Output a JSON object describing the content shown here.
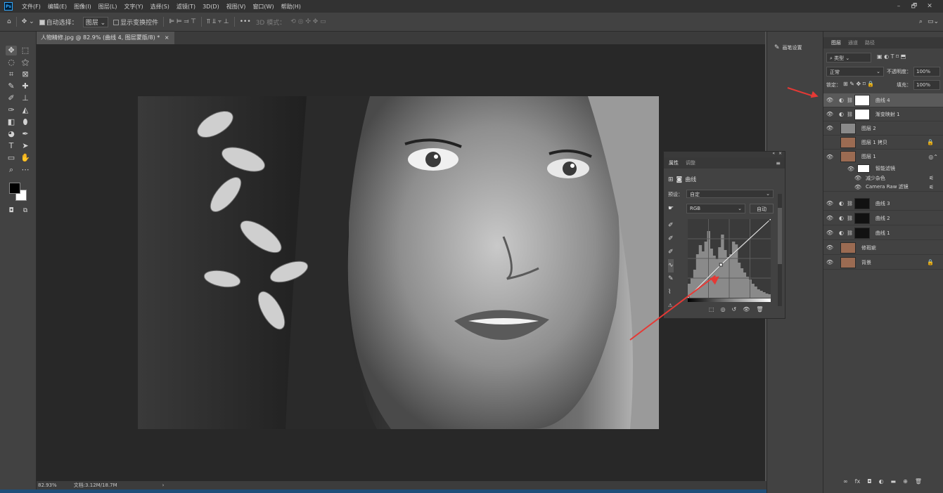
{
  "menubar": {
    "logo": "Ps",
    "items": [
      "文件(F)",
      "编辑(E)",
      "图像(I)",
      "图层(L)",
      "文字(Y)",
      "选择(S)",
      "滤镜(T)",
      "3D(D)",
      "视图(V)",
      "窗口(W)",
      "帮助(H)"
    ],
    "minimize": "–",
    "restore": "🗗",
    "close": "✕"
  },
  "options": {
    "auto_select_label": "自动选择：",
    "auto_select_target": "图层",
    "show_transform_label": "显示变换控件",
    "more": "•••",
    "mode_3d_label": "3D 模式："
  },
  "document": {
    "tab_title": "人物精修.jpg @ 82.9% (曲线 4, 图层蒙版/8) *",
    "tab_close": "×",
    "zoom": "82.93%",
    "file_info": "文档:3.12M/18.7M",
    "status_arrow": "›"
  },
  "brush_panel": {
    "label": "画笔设置"
  },
  "layers_panel": {
    "tabs": [
      "图层",
      "通道",
      "路径"
    ],
    "filter_kind": "类型",
    "blend_mode": "正常",
    "opacity_label": "不透明度：",
    "opacity_value": "100%",
    "lock_label": "锁定：",
    "fill_label": "填充：",
    "fill_value": "100%",
    "layers": [
      {
        "name": "曲线 4",
        "selected": true
      },
      {
        "name": "渐变映射 1",
        "selected": false
      },
      {
        "name": "图层 2",
        "selected": false
      },
      {
        "name": "图层 1 拷贝",
        "selected": false
      },
      {
        "name": "图层 1",
        "selected": false
      },
      {
        "name": "智能滤镜",
        "selected": false
      },
      {
        "name": "减少杂色",
        "selected": false
      },
      {
        "name": "Camera Raw 滤镜",
        "selected": false
      },
      {
        "name": "曲线 3",
        "selected": false
      },
      {
        "name": "曲线 2",
        "selected": false
      },
      {
        "name": "曲线 1",
        "selected": false
      },
      {
        "name": "修瑕疵",
        "selected": false
      },
      {
        "name": "背景",
        "selected": false
      }
    ],
    "footer": [
      "∞",
      "fx",
      "◘",
      "◐",
      "▬",
      "⊕",
      "🗑"
    ]
  },
  "properties_panel": {
    "tabs": [
      "属性",
      "调整"
    ],
    "title": "曲线",
    "preset_label": "预设：",
    "preset_value": "自定",
    "channel": "RGB",
    "auto_button": "自动",
    "collapse": "«",
    "close": "×",
    "menu": "≡"
  },
  "curve": {
    "points": [
      [
        0,
        0
      ],
      [
        0.4,
        0.42
      ],
      [
        1,
        1
      ]
    ]
  },
  "colors": {
    "foreground": "#000000",
    "background": "#ffffff",
    "annotation_arrow": "#e53935"
  }
}
